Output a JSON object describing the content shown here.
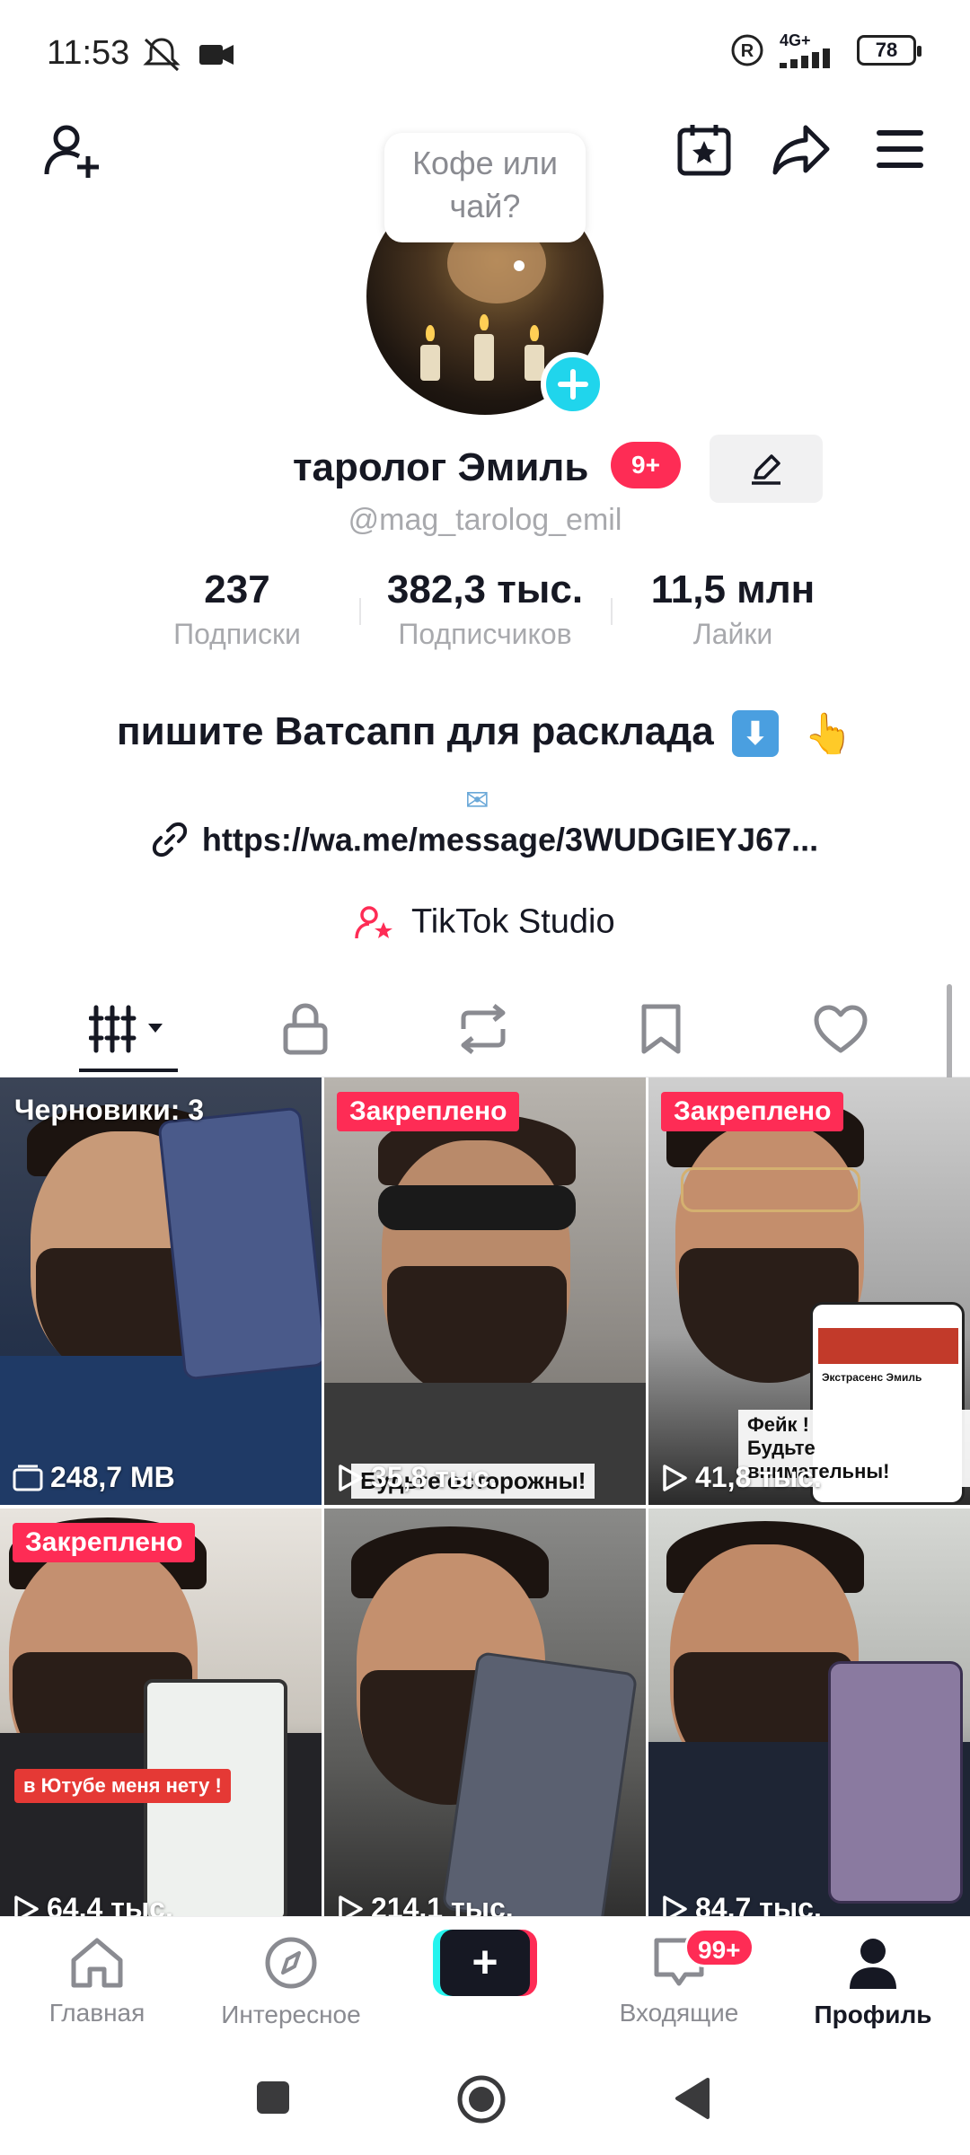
{
  "status_bar": {
    "time": "11:53",
    "network": "4G+",
    "battery": "78",
    "icons": [
      "mute-icon",
      "camera-icon",
      "registered-icon",
      "signal-icon",
      "battery-icon"
    ]
  },
  "top_bar": {
    "icons": [
      "add-user-icon",
      "calendar-star-icon",
      "share-icon",
      "menu-icon"
    ]
  },
  "profile": {
    "status_bubble": "Кофе или чай?",
    "name": "таролог Эмиль",
    "name_badge": "9+",
    "handle": "@mag_tarolog_emil",
    "stats": [
      {
        "value": "237",
        "label": "Подписки"
      },
      {
        "value": "382,3 тыс.",
        "label": "Подписчиков"
      },
      {
        "value": "11,5 млн",
        "label": "Лайки"
      }
    ],
    "bio": "пишите Ватсапп для расклада",
    "bio_emoji_arrow": "⬇",
    "bio_emoji_hand": "👆",
    "bio_envelope": "✉",
    "link": "https://wa.me/message/3WUDGIEYJ67...",
    "studio": "TikTok Studio"
  },
  "tabs": [
    {
      "icon": "videos-grid-icon",
      "active": true
    },
    {
      "icon": "lock-icon"
    },
    {
      "icon": "repost-icon"
    },
    {
      "icon": "bookmark-icon"
    },
    {
      "icon": "heart-icon"
    }
  ],
  "videos": [
    {
      "label": "Черновики: 3",
      "stat": "248,7 MB",
      "stat_icon": "folder-icon"
    },
    {
      "badge": "Закреплено",
      "stat": "35,8 тыс.",
      "stat_icon": "play-icon",
      "overlay": "Будьте осторожны!"
    },
    {
      "badge": "Закреплено",
      "stat": "41,8 тыс.",
      "stat_icon": "play-icon",
      "overlay": "Фейк !\nБудьте внимательны!",
      "inner_title": "Экстрасенс Эмиль"
    },
    {
      "badge": "Закреплено",
      "stat": "64,4 тыс.",
      "stat_icon": "play-icon",
      "overlay": "в Ютубе меня нету !"
    },
    {
      "stat": "214,1 тыс.",
      "stat_icon": "play-icon"
    },
    {
      "stat": "84,7 тыс.",
      "stat_icon": "play-icon"
    }
  ],
  "bottom_nav": [
    {
      "label": "Главная",
      "icon": "home-icon"
    },
    {
      "label": "Интересное",
      "icon": "compass-icon"
    },
    {
      "label": "",
      "icon": "create-plus-icon"
    },
    {
      "label": "Входящие",
      "icon": "inbox-icon",
      "badge": "99+"
    },
    {
      "label": "Профиль",
      "icon": "profile-icon",
      "active": true
    }
  ],
  "colors": {
    "accent": "#fe2c55",
    "cyan": "#25f4ee",
    "text": "#161823",
    "muted": "#a8a9ad"
  }
}
